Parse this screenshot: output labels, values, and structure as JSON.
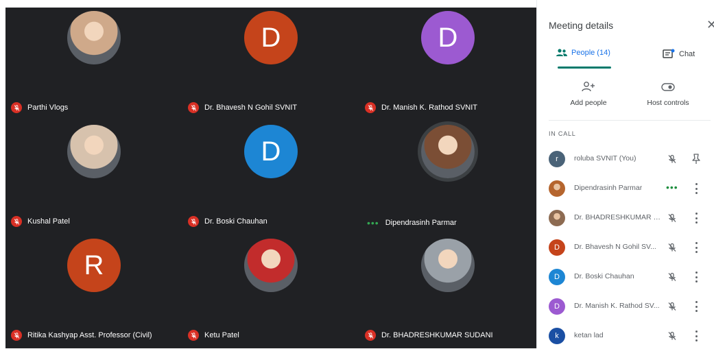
{
  "colors": {
    "grid_bg": "#202124",
    "mute_red": "#d93025",
    "accent_teal": "#00796b",
    "tab_active": "#1a73e8",
    "speaking_green": "#34a853"
  },
  "grid": {
    "tiles": [
      {
        "name": "Parthi Vlogs",
        "initial": "",
        "avatar_type": "photo",
        "avatar_color": "#cfa98a",
        "status": "muted"
      },
      {
        "name": "Dr. Bhavesh N Gohil SVNIT",
        "initial": "D",
        "avatar_type": "letter",
        "avatar_color": "#c5441b",
        "status": "muted"
      },
      {
        "name": "Dr. Manish K. Rathod SVNIT",
        "initial": "D",
        "avatar_type": "letter",
        "avatar_color": "#9c5ad1",
        "status": "muted"
      },
      {
        "name": "Kushal Patel",
        "initial": "",
        "avatar_type": "photo",
        "avatar_color": "#d7c2ad",
        "status": "muted"
      },
      {
        "name": "Dr. Boski Chauhan",
        "initial": "D",
        "avatar_type": "letter",
        "avatar_color": "#1d86d4",
        "status": "muted"
      },
      {
        "name": "Dipendrasinh Parmar",
        "initial": "",
        "avatar_type": "photo",
        "avatar_color": "#7b4e35",
        "status": "speaking"
      },
      {
        "name": "Ritika Kashyap Asst. Professor (Civil)",
        "initial": "R",
        "avatar_type": "letter",
        "avatar_color": "#c5441b",
        "status": "muted"
      },
      {
        "name": "Ketu Patel",
        "initial": "",
        "avatar_type": "photo",
        "avatar_color": "#c22c2c",
        "status": "muted"
      },
      {
        "name": "Dr. BHADRESHKUMAR SUDANI",
        "initial": "",
        "avatar_type": "photo",
        "avatar_color": "#9aa1a8",
        "status": "muted"
      }
    ]
  },
  "panel": {
    "title": "Meeting details",
    "close_icon": "close-icon",
    "tabs": [
      {
        "label": "People (14)",
        "icon": "people-icon",
        "active": true
      },
      {
        "label": "Chat",
        "icon": "chat-icon",
        "active": false
      }
    ],
    "actions": [
      {
        "label": "Add people",
        "icon": "add-person-icon"
      },
      {
        "label": "Host controls",
        "icon": "toggle-icon"
      }
    ],
    "section_label": "IN CALL",
    "participants": [
      {
        "name": "roluba SVNIT (You)",
        "initial": "r",
        "avatar_color": "#4a6378",
        "avatar_type": "letter",
        "status": "muted",
        "action": "pin"
      },
      {
        "name": "Dipendrasinh Parmar",
        "initial": "",
        "avatar_color": "#b5652e",
        "avatar_type": "photo",
        "status": "speaking",
        "action": "more"
      },
      {
        "name": "Dr. BHADRESHKUMAR S...",
        "initial": "",
        "avatar_color": "#8d6b52",
        "avatar_type": "photo",
        "status": "muted",
        "action": "more"
      },
      {
        "name": "Dr. Bhavesh N Gohil SV...",
        "initial": "D",
        "avatar_color": "#c5441b",
        "avatar_type": "letter",
        "status": "muted",
        "action": "more"
      },
      {
        "name": "Dr. Boski Chauhan",
        "initial": "D",
        "avatar_color": "#1d86d4",
        "avatar_type": "letter",
        "status": "muted",
        "action": "more"
      },
      {
        "name": "Dr. Manish K. Rathod SV...",
        "initial": "D",
        "avatar_color": "#9c5ad1",
        "avatar_type": "letter",
        "status": "muted",
        "action": "more"
      },
      {
        "name": "ketan lad",
        "initial": "k",
        "avatar_color": "#1a4fa3",
        "avatar_type": "letter",
        "status": "muted",
        "action": "more"
      }
    ]
  }
}
